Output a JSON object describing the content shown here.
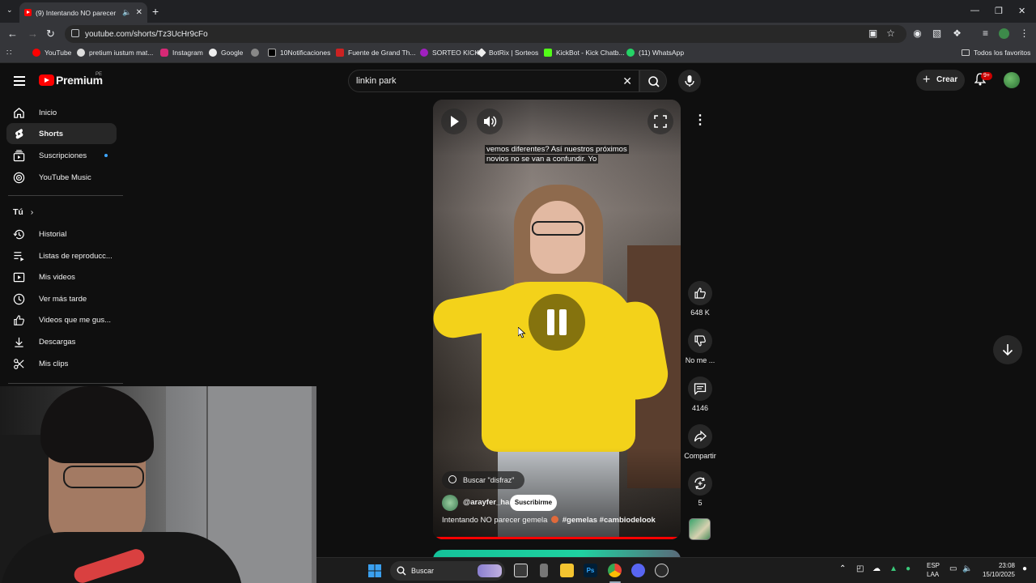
{
  "browser": {
    "tab_title": "(9) Intentando NO parecer gemela",
    "url": "youtube.com/shorts/Tz3UcHr9cFo",
    "bookmarks": [
      "YouTube",
      "pretium iustum mat...",
      "Instagram",
      "Google",
      "",
      "10Notificaciones",
      "Fuente de Grand Th...",
      "SORTEO KICK",
      "BotRix | Sorteos",
      "KickBot - Kick Chatb...",
      "(11) WhatsApp"
    ],
    "all_bookmarks": "Todos los favoritos"
  },
  "masthead": {
    "logo": "Premium",
    "region": "PE",
    "search_value": "linkin park",
    "create_label": "Crear",
    "notif_badge": "9+"
  },
  "sidebar": {
    "items": [
      {
        "label": "Inicio",
        "icon": "home-icon"
      },
      {
        "label": "Shorts",
        "icon": "shorts-icon"
      },
      {
        "label": "Suscripciones",
        "icon": "subscriptions-icon"
      },
      {
        "label": "YouTube Music",
        "icon": "music-icon"
      }
    ],
    "you_label": "Tú",
    "you_items": [
      {
        "label": "Historial",
        "icon": "history-icon"
      },
      {
        "label": "Listas de reproducc...",
        "icon": "playlists-icon"
      },
      {
        "label": "Mis videos",
        "icon": "my-videos-icon"
      },
      {
        "label": "Ver más tarde",
        "icon": "watch-later-icon"
      },
      {
        "label": "Videos que me gus...",
        "icon": "liked-icon"
      },
      {
        "label": "Descargas",
        "icon": "downloads-icon"
      },
      {
        "label": "Mis clips",
        "icon": "clips-icon"
      }
    ]
  },
  "short": {
    "caption_line1": "vemos diferentes? Así nuestros próximos",
    "caption_line2": "novios no se van a confundir. Yo",
    "search_chip": "Buscar \"disfraz\"",
    "channel": "@arayfer_ha",
    "subscribe": "Suscribirme",
    "title_text": "Intentando NO parecer gemela",
    "hashtags": "#gemelas #cambiodelook",
    "progress_fraction": 0.99
  },
  "actions": {
    "likes": "648 K",
    "dislike": "No me ...",
    "comments": "4146",
    "share": "Compartir",
    "remix": "5"
  },
  "taskbar": {
    "search_label": "Buscar",
    "lang_1": "ESP",
    "lang_2": "LAA",
    "time": "23:08",
    "date": "15/10/2025"
  }
}
